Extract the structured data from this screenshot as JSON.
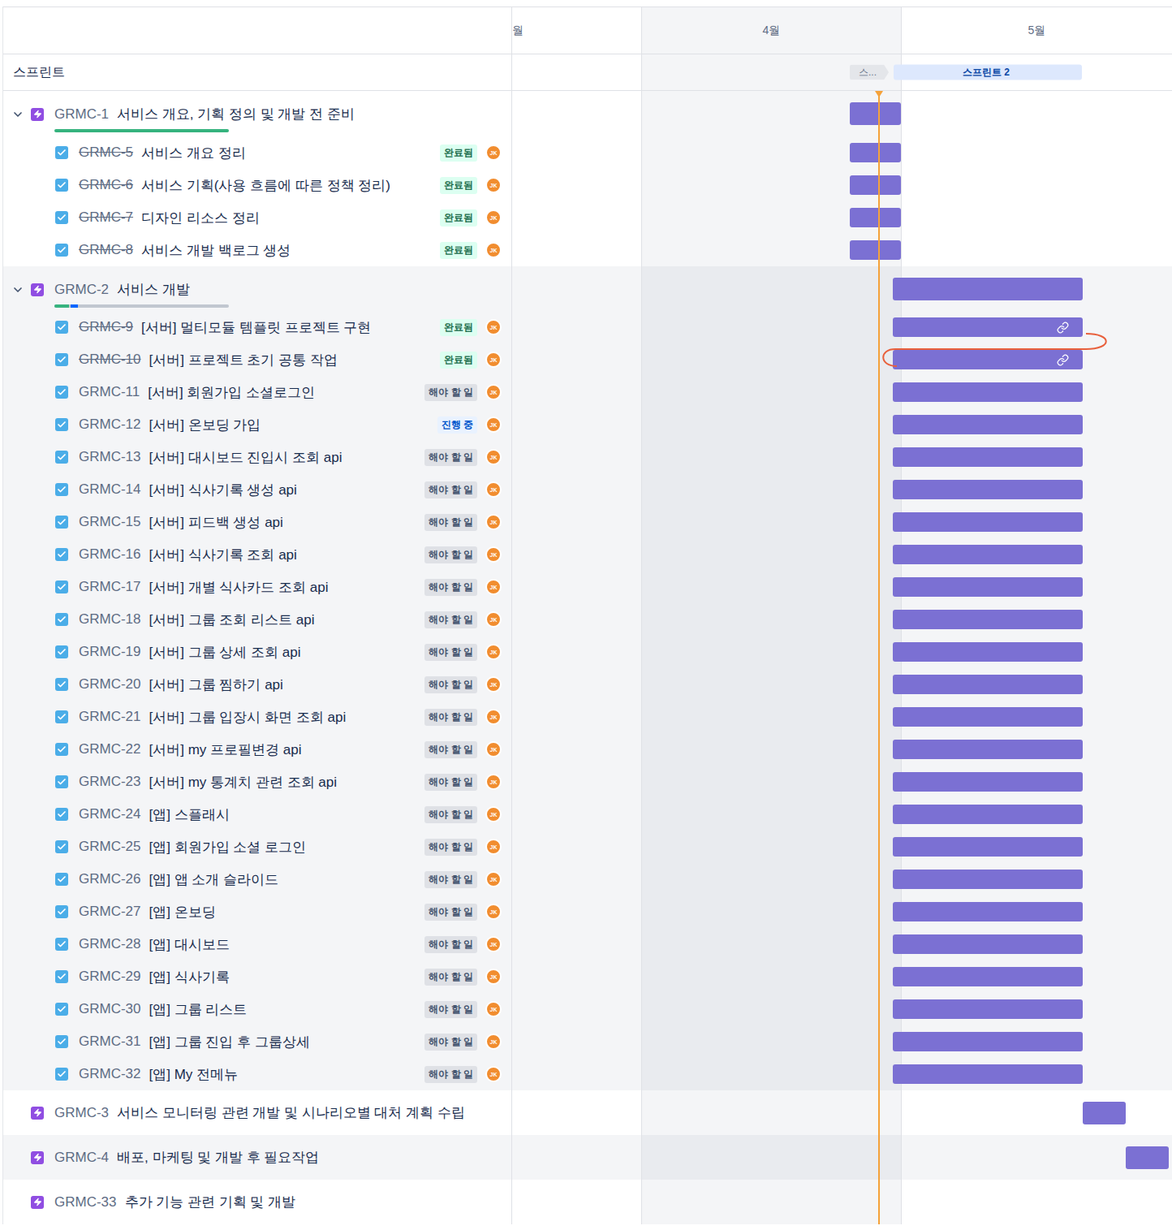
{
  "header": {
    "months": [
      {
        "label": "월",
        "shaded": false
      },
      {
        "label": "4월",
        "shaded": true
      },
      {
        "label": "5월",
        "shaded": false
      }
    ]
  },
  "sprints": {
    "label": "스프린트",
    "items": [
      {
        "label": "스...",
        "schedule": "sprint-1",
        "active": false
      },
      {
        "label": "스프린트 2",
        "schedule": "sprint-2",
        "active": true
      }
    ]
  },
  "epics": [
    {
      "key": "GRMC-1",
      "title": "서비스 개요, 기획 정의 및 개발 전 준비",
      "expanded": true,
      "schedule": "sprint-1",
      "progress": {
        "done": 1,
        "in_progress": 0
      },
      "children": [
        {
          "key": "GRMC-5",
          "title": "서비스 개요 정리",
          "status": "완료됨",
          "kind": "done",
          "assignee": "JK",
          "schedule": "sprint-1",
          "linked": false
        },
        {
          "key": "GRMC-6",
          "title": "서비스 기획(사용 흐름에 따른 정책 정리)",
          "status": "완료됨",
          "kind": "done",
          "assignee": "JK",
          "schedule": "sprint-1",
          "linked": false
        },
        {
          "key": "GRMC-7",
          "title": "디자인 리소스 정리",
          "status": "완료됨",
          "kind": "done",
          "assignee": "JK",
          "schedule": "sprint-1",
          "linked": false
        },
        {
          "key": "GRMC-8",
          "title": "서비스 개발 백로그 생성",
          "status": "완료됨",
          "kind": "done",
          "assignee": "JK",
          "schedule": "sprint-1",
          "linked": false
        }
      ]
    },
    {
      "key": "GRMC-2",
      "title": "서비스 개발",
      "expanded": true,
      "schedule": "sprint-2",
      "progress": {
        "done": 0.083,
        "in_progress": 0.042
      },
      "children": [
        {
          "key": "GRMC-9",
          "title": "[서버] 멀티모듈 템플릿 프로젝트 구현",
          "status": "완료됨",
          "kind": "done",
          "assignee": "JK",
          "schedule": "sprint-2",
          "linked": true
        },
        {
          "key": "GRMC-10",
          "title": "[서버] 프로젝트 초기 공통 작업",
          "status": "완료됨",
          "kind": "done",
          "assignee": "JK",
          "schedule": "sprint-2",
          "linked": true
        },
        {
          "key": "GRMC-11",
          "title": "[서버] 회원가입 소셜로그인",
          "status": "해야 할 일",
          "kind": "todo",
          "assignee": "JK",
          "schedule": "sprint-2",
          "linked": false
        },
        {
          "key": "GRMC-12",
          "title": "[서버] 온보딩 가입",
          "status": "진행 중",
          "kind": "in-progress",
          "assignee": "JK",
          "schedule": "sprint-2",
          "linked": false
        },
        {
          "key": "GRMC-13",
          "title": "[서버] 대시보드 진입시 조회 api",
          "status": "해야 할 일",
          "kind": "todo",
          "assignee": "JK",
          "schedule": "sprint-2",
          "linked": false
        },
        {
          "key": "GRMC-14",
          "title": "[서버] 식사기록 생성 api",
          "status": "해야 할 일",
          "kind": "todo",
          "assignee": "JK",
          "schedule": "sprint-2",
          "linked": false
        },
        {
          "key": "GRMC-15",
          "title": "[서버] 피드백 생성 api",
          "status": "해야 할 일",
          "kind": "todo",
          "assignee": "JK",
          "schedule": "sprint-2",
          "linked": false
        },
        {
          "key": "GRMC-16",
          "title": "[서버] 식사기록 조회 api",
          "status": "해야 할 일",
          "kind": "todo",
          "assignee": "JK",
          "schedule": "sprint-2",
          "linked": false
        },
        {
          "key": "GRMC-17",
          "title": "[서버] 개별 식사카드 조회 api",
          "status": "해야 할 일",
          "kind": "todo",
          "assignee": "JK",
          "schedule": "sprint-2",
          "linked": false
        },
        {
          "key": "GRMC-18",
          "title": "[서버] 그룹 조회 리스트 api",
          "status": "해야 할 일",
          "kind": "todo",
          "assignee": "JK",
          "schedule": "sprint-2",
          "linked": false
        },
        {
          "key": "GRMC-19",
          "title": "[서버] 그룹 상세 조회 api",
          "status": "해야 할 일",
          "kind": "todo",
          "assignee": "JK",
          "schedule": "sprint-2",
          "linked": false
        },
        {
          "key": "GRMC-20",
          "title": "[서버] 그룹 찜하기 api",
          "status": "해야 할 일",
          "kind": "todo",
          "assignee": "JK",
          "schedule": "sprint-2",
          "linked": false
        },
        {
          "key": "GRMC-21",
          "title": "[서버] 그룹 입장시 화면 조회 api",
          "status": "해야 할 일",
          "kind": "todo",
          "assignee": "JK",
          "schedule": "sprint-2",
          "linked": false
        },
        {
          "key": "GRMC-22",
          "title": "[서버] my 프로필변경 api",
          "status": "해야 할 일",
          "kind": "todo",
          "assignee": "JK",
          "schedule": "sprint-2",
          "linked": false
        },
        {
          "key": "GRMC-23",
          "title": "[서버] my 통계치 관련 조회 api",
          "status": "해야 할 일",
          "kind": "todo",
          "assignee": "JK",
          "schedule": "sprint-2",
          "linked": false
        },
        {
          "key": "GRMC-24",
          "title": "[앱] 스플래시",
          "status": "해야 할 일",
          "kind": "todo",
          "assignee": "JK",
          "schedule": "sprint-2",
          "linked": false
        },
        {
          "key": "GRMC-25",
          "title": "[앱] 회원가입 소셜 로그인",
          "status": "해야 할 일",
          "kind": "todo",
          "assignee": "JK",
          "schedule": "sprint-2",
          "linked": false
        },
        {
          "key": "GRMC-26",
          "title": "[앱] 앱 소개 슬라이드",
          "status": "해야 할 일",
          "kind": "todo",
          "assignee": "JK",
          "schedule": "sprint-2",
          "linked": false
        },
        {
          "key": "GRMC-27",
          "title": "[앱] 온보딩",
          "status": "해야 할 일",
          "kind": "todo",
          "assignee": "JK",
          "schedule": "sprint-2",
          "linked": false
        },
        {
          "key": "GRMC-28",
          "title": "[앱] 대시보드",
          "status": "해야 할 일",
          "kind": "todo",
          "assignee": "JK",
          "schedule": "sprint-2",
          "linked": false
        },
        {
          "key": "GRMC-29",
          "title": "[앱] 식사기록",
          "status": "해야 할 일",
          "kind": "todo",
          "assignee": "JK",
          "schedule": "sprint-2",
          "linked": false
        },
        {
          "key": "GRMC-30",
          "title": "[앱] 그룹 리스트",
          "status": "해야 할 일",
          "kind": "todo",
          "assignee": "JK",
          "schedule": "sprint-2",
          "linked": false
        },
        {
          "key": "GRMC-31",
          "title": "[앱] 그룹 진입 후 그룹상세",
          "status": "해야 할 일",
          "kind": "todo",
          "assignee": "JK",
          "schedule": "sprint-2",
          "linked": false
        },
        {
          "key": "GRMC-32",
          "title": "[앱] My 전메뉴",
          "status": "해야 할 일",
          "kind": "todo",
          "assignee": "JK",
          "schedule": "sprint-2",
          "linked": false
        }
      ]
    },
    {
      "key": "GRMC-3",
      "title": "서비스 모니터링 관련 개발 및 시나리오별 대처 계획 수립",
      "expanded": false,
      "schedule": "after-sprint-2",
      "children": []
    },
    {
      "key": "GRMC-4",
      "title": "배포, 마케팅 및 개발 후 필요작업",
      "expanded": false,
      "schedule": "later",
      "children": []
    },
    {
      "key": "GRMC-33",
      "title": "추가 기능 관련 기획 및 개발",
      "expanded": false,
      "schedule": "none",
      "children": []
    }
  ]
}
